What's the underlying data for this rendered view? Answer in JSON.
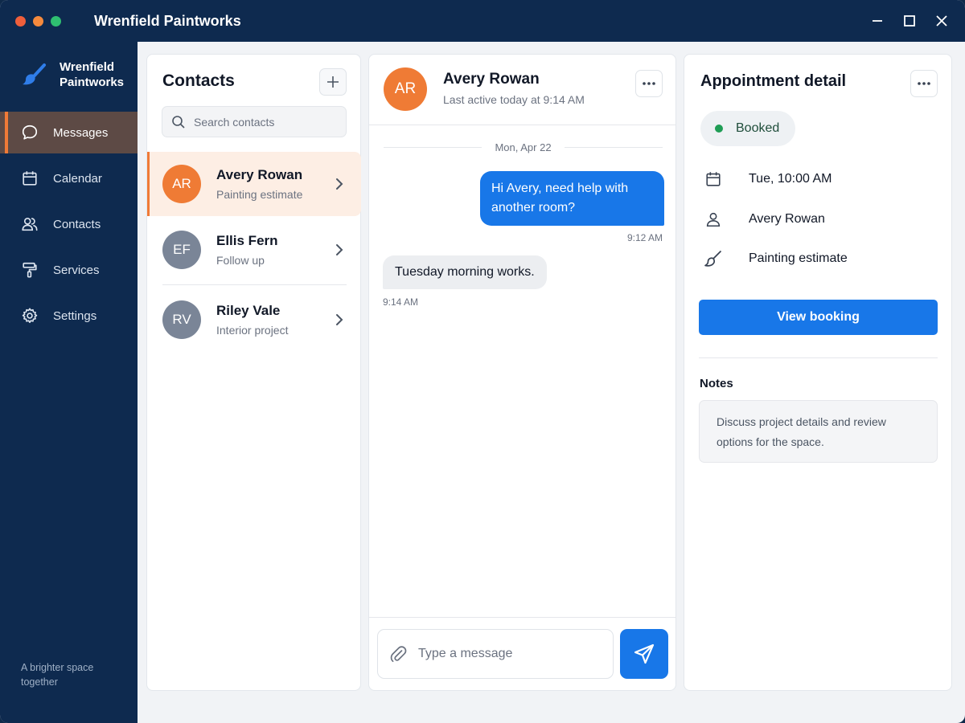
{
  "window": {
    "title": "Wrenfield Paintworks",
    "traffic_lights": [
      "#ef5f3b",
      "#f58a3d",
      "#2fbf71"
    ]
  },
  "sidebar": {
    "brand": "Wrenfield Paintworks",
    "items": [
      {
        "label": "Messages",
        "icon": "chat-bubble-icon",
        "active": true
      },
      {
        "label": "Calendar",
        "icon": "calendar-icon",
        "active": false
      },
      {
        "label": "Contacts",
        "icon": "people-icon",
        "active": false
      },
      {
        "label": "Services",
        "icon": "paint-roller-icon",
        "active": false
      },
      {
        "label": "Settings",
        "icon": "gear-icon",
        "active": false
      }
    ],
    "tagline": "A brighter space together"
  },
  "contacts": {
    "title": "Contacts",
    "search_placeholder": "Search contacts",
    "list": [
      {
        "initials": "AR",
        "name": "Avery Rowan",
        "subtitle": "Painting estimate",
        "avatar_color": "#ef7b35",
        "active": true
      },
      {
        "initials": "EF",
        "name": "Ellis Fern",
        "subtitle": "Follow up",
        "avatar_color": "#7a8597",
        "active": false
      },
      {
        "initials": "RV",
        "name": "Riley Vale",
        "subtitle": "Interior project",
        "avatar_color": "#7a8597",
        "active": false
      }
    ]
  },
  "chat": {
    "initials": "AR",
    "name": "Avery Rowan",
    "status": "Last active today at 9:14 AM",
    "date_separator": "Mon, Apr 22",
    "messages": [
      {
        "direction": "out",
        "text": "Hi Avery, need help with another room?",
        "time": "9:12 AM"
      },
      {
        "direction": "in",
        "text": "Tuesday morning works.",
        "time": "9:14 AM"
      }
    ],
    "composer_placeholder": "Type a message"
  },
  "detail": {
    "title": "Appointment detail",
    "status": "Booked",
    "when": "Tue, 10:00 AM",
    "client": "Avery Rowan",
    "service": "Painting estimate",
    "primary_button": "View booking",
    "notes_label": "Notes",
    "notes": "Discuss project details and review options for the space."
  },
  "colors": {
    "navy": "#0e2a4f",
    "accent_orange": "#f07a37",
    "primary_blue": "#1877e8",
    "booked_green": "#1f9d55"
  }
}
